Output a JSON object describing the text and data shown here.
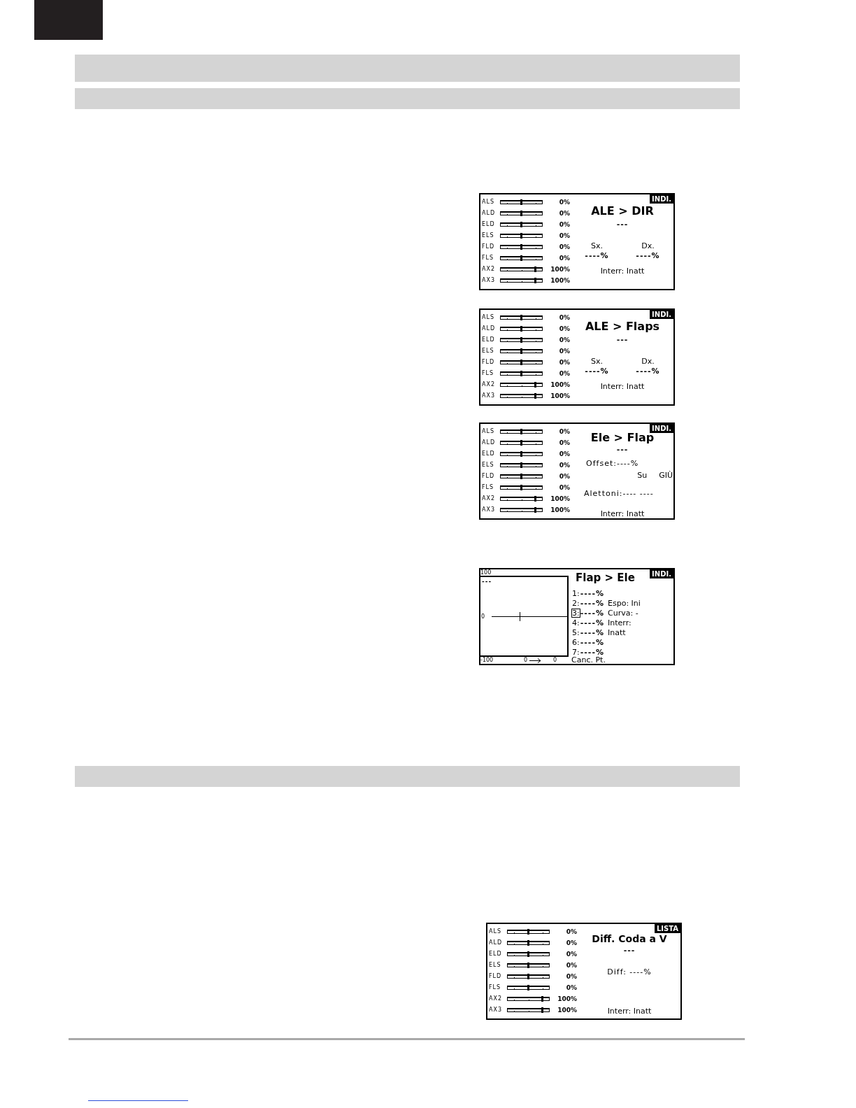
{
  "sections": [
    {
      "screens": [
        {
          "kind": "mix",
          "tag": "INDI.",
          "title": "ALE > DIR",
          "value": "---",
          "channels": [
            {
              "label": "ALS",
              "level": 0.5,
              "reading": "0%"
            },
            {
              "label": "ALD",
              "level": 0.5,
              "reading": "0%"
            },
            {
              "label": "ELD",
              "level": 0.5,
              "reading": "0%"
            },
            {
              "label": "ELS",
              "level": 0.5,
              "reading": "0%"
            },
            {
              "label": "FLD",
              "level": 0.5,
              "reading": "0%"
            },
            {
              "label": "FLS",
              "level": 0.5,
              "reading": "0%"
            },
            {
              "label": "AX2",
              "level": 0.83,
              "reading": "100%"
            },
            {
              "label": "AX3",
              "level": 0.83,
              "reading": "100%"
            }
          ],
          "sides": [
            {
              "label": "Sx.",
              "value": "----%"
            },
            {
              "label": "Dx.",
              "value": "----%"
            }
          ],
          "switch": "Interr: Inatt"
        },
        {
          "kind": "mix",
          "tag": "INDI.",
          "title": "ALE > Flaps",
          "value": "---",
          "channels": [
            {
              "label": "ALS",
              "level": 0.5,
              "reading": "0%"
            },
            {
              "label": "ALD",
              "level": 0.5,
              "reading": "0%"
            },
            {
              "label": "ELD",
              "level": 0.5,
              "reading": "0%"
            },
            {
              "label": "ELS",
              "level": 0.5,
              "reading": "0%"
            },
            {
              "label": "FLD",
              "level": 0.5,
              "reading": "0%"
            },
            {
              "label": "FLS",
              "level": 0.5,
              "reading": "0%"
            },
            {
              "label": "AX2",
              "level": 0.83,
              "reading": "100%"
            },
            {
              "label": "AX3",
              "level": 0.83,
              "reading": "100%"
            }
          ],
          "sides": [
            {
              "label": "Sx.",
              "value": "----%"
            },
            {
              "label": "Dx.",
              "value": "----%"
            }
          ],
          "switch": "Interr: Inatt"
        },
        {
          "kind": "offset",
          "tag": "INDI.",
          "title": "Ele > Flap",
          "value": "---",
          "channels": [
            {
              "label": "ALS",
              "level": 0.5,
              "reading": "0%"
            },
            {
              "label": "ALD",
              "level": 0.5,
              "reading": "0%"
            },
            {
              "label": "ELD",
              "level": 0.5,
              "reading": "0%"
            },
            {
              "label": "ELS",
              "level": 0.5,
              "reading": "0%"
            },
            {
              "label": "FLD",
              "level": 0.5,
              "reading": "0%"
            },
            {
              "label": "FLS",
              "level": 0.5,
              "reading": "0%"
            },
            {
              "label": "AX2",
              "level": 0.83,
              "reading": "100%"
            },
            {
              "label": "AX3",
              "level": 0.83,
              "reading": "100%"
            }
          ],
          "offset": "Offset:----%",
          "directions": [
            "Su",
            "GIÙ"
          ],
          "ailerons": "Alettoni:---- ----",
          "switch": "Interr: Inatt"
        },
        {
          "kind": "curve",
          "tag": "INDI.",
          "title": "Flap > Ele",
          "graph": {
            "top_label": "100",
            "value": "---",
            "mid_label": "0",
            "bottom_label": "-100",
            "range_from": "0",
            "range_to": "0"
          },
          "points": [
            {
              "label": "1:",
              "value": "----%",
              "selected": false
            },
            {
              "label": "2:",
              "value": "----%",
              "selected": false
            },
            {
              "label": "3:",
              "value": "----%",
              "selected": true
            },
            {
              "label": "4:",
              "value": "----%",
              "selected": false
            },
            {
              "label": "5:",
              "value": "----%",
              "selected": false
            },
            {
              "label": "6:",
              "value": "----%",
              "selected": false
            },
            {
              "label": "7:",
              "value": "----%",
              "selected": false
            }
          ],
          "options": [
            "Espo: Ini",
            "Curva: -",
            "Interr:",
            "Inatt"
          ],
          "action": "Canc. Pt."
        }
      ]
    },
    {
      "screens": [
        {
          "kind": "diff",
          "tag": "LISTA",
          "title": "Diff. Coda a V",
          "value": "---",
          "channels": [
            {
              "label": "ALS",
              "level": 0.5,
              "reading": "0%"
            },
            {
              "label": "ALD",
              "level": 0.5,
              "reading": "0%"
            },
            {
              "label": "ELD",
              "level": 0.5,
              "reading": "0%"
            },
            {
              "label": "ELS",
              "level": 0.5,
              "reading": "0%"
            },
            {
              "label": "FLD",
              "level": 0.5,
              "reading": "0%"
            },
            {
              "label": "FLS",
              "level": 0.5,
              "reading": "0%"
            },
            {
              "label": "AX2",
              "level": 0.83,
              "reading": "100%"
            },
            {
              "label": "AX3",
              "level": 0.83,
              "reading": "100%"
            }
          ],
          "diff": "Diff: ----%",
          "switch": "Interr: Inatt"
        }
      ]
    }
  ]
}
